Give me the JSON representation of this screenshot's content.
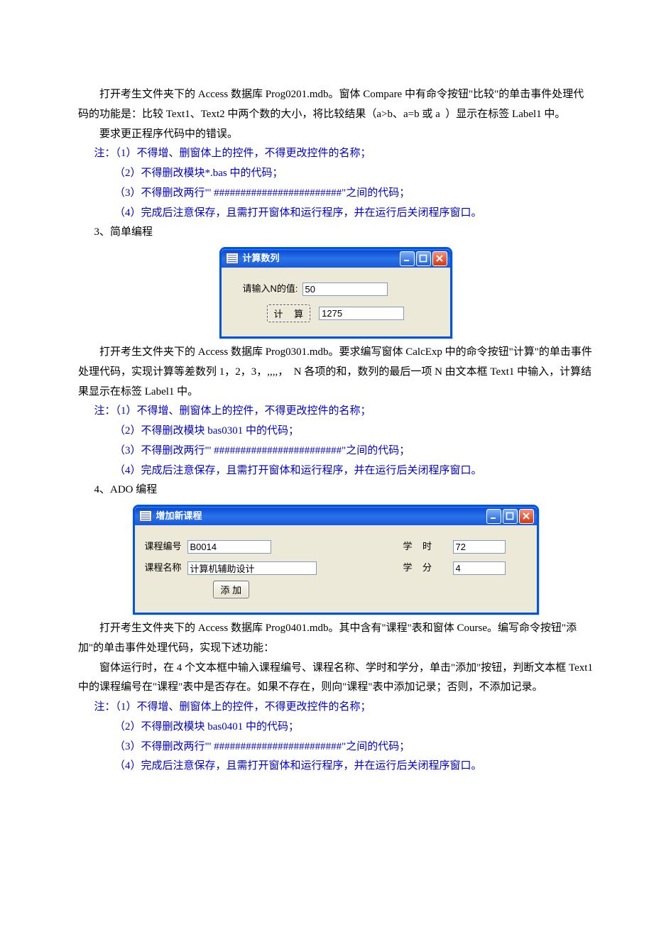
{
  "section1": {
    "p1": "打开考生文件夹下的 Access 数据库 Prog0201.mdb。窗体 Compare 中有命令按钮\"比较\"的单击事件处理代码的功能是：比较 Text1、Text2 中两个数的大小，将比较结果（a>b、a=b 或 a  ）显示在标签 Label1 中。",
    "p2": "要求更正程序代码中的错误。",
    "note1": "注：（1）不得增、删窗体上的控件，不得更改控件的名称；",
    "note2": "（2）不得删改模块*.bas 中的代码；",
    "note3": "（3）不得删改两行\"' ########################\"之间的代码；",
    "note4": "（4）完成后注意保存，且需打开窗体和运行程序，并在运行后关闭程序窗口。",
    "p3": "3、简单编程"
  },
  "form1": {
    "title": "计算数列",
    "label_n": "请输入N的值:",
    "value_n": "50",
    "btn_calc": "计 算",
    "result": "1275"
  },
  "section2": {
    "p1": "打开考生文件夹下的 Access 数据库 Prog0301.mdb。要求编写窗体 CalcExp 中的命令按钮\"计算\"的单击事件处理代码，实现计算等差数列 1，2，3，,,,,，  N 各项的和，数列的最后一项 N 由文本框 Text1 中输入，计算结果显示在标签 Label1 中。",
    "note1": "注：（1）不得增、删窗体上的控件，不得更改控件的名称；",
    "note2": "（2）不得删改模块 bas0301 中的代码；",
    "note3": "（3）不得删改两行\"' ########################\"之间的代码；",
    "note4": "（4）完成后注意保存，且需打开窗体和运行程序，并在运行后关闭程序窗口。",
    "p2": "4、ADO 编程"
  },
  "form2": {
    "title": "增加新课程",
    "label_id": "课程编号",
    "value_id": "B0014",
    "label_hours": "学    时",
    "value_hours": "72",
    "label_name": "课程名称",
    "value_name": "计算机辅助设计",
    "label_credit": "学    分",
    "value_credit": "4",
    "btn_add": "添  加"
  },
  "section3": {
    "p1": "打开考生文件夹下的 Access 数据库 Prog0401.mdb。其中含有\"课程\"表和窗体 Course。编写命令按钮\"添加\"的单击事件处理代码，实现下述功能：",
    "p2": "窗体运行时，在 4 个文本框中输入课程编号、课程名称、学时和学分，单击\"添加\"按钮，判断文本框 Text1 中的课程编号在\"课程\"表中是否存在。如果不存在，则向\"课程\"表中添加记录；否则，不添加记录。",
    "note1": "注：（1）不得增、删窗体上的控件，不得更改控件的名称；",
    "note2": "（2）不得删改模块 bas0401 中的代码；",
    "note3": "（3）不得删改两行\"' ########################\"之间的代码；",
    "note4": "（4）完成后注意保存，且需打开窗体和运行程序，并在运行后关闭程序窗口。"
  }
}
